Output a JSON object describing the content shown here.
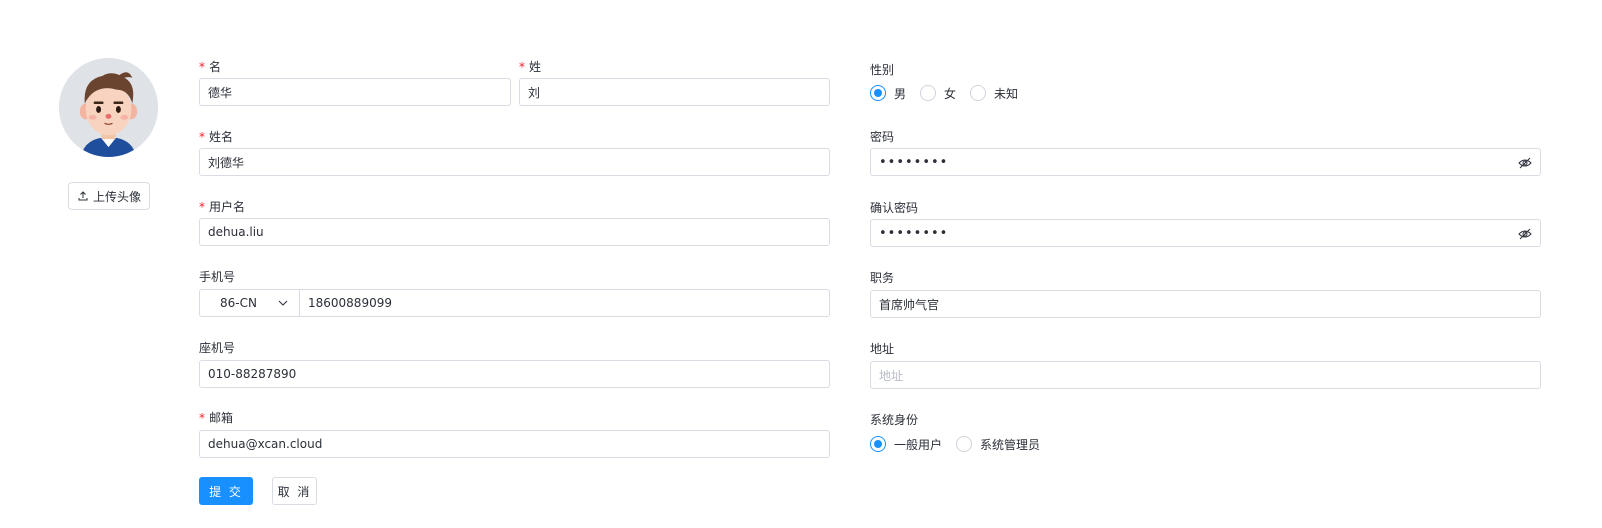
{
  "avatar": {
    "upload_label": "上传头像"
  },
  "form": {
    "first_name": {
      "label": "名",
      "value": "德华",
      "required": true
    },
    "last_name": {
      "label": "姓",
      "value": "刘",
      "required": true
    },
    "full_name": {
      "label": "姓名",
      "value": "刘德华",
      "required": true
    },
    "username": {
      "label": "用户名",
      "value": "dehua.liu",
      "required": true
    },
    "mobile": {
      "label": "手机号",
      "country_code": "86-CN",
      "value": "18600889099"
    },
    "landline": {
      "label": "座机号",
      "value": "010-88287890"
    },
    "email": {
      "label": "邮箱",
      "value": "dehua@xcan.cloud",
      "required": true
    },
    "gender": {
      "label": "性别",
      "options": [
        "男",
        "女",
        "未知"
      ],
      "selected": "男"
    },
    "password": {
      "label": "密码",
      "value": "••••••••"
    },
    "confirm_password": {
      "label": "确认密码",
      "value": "••••••••"
    },
    "title": {
      "label": "职务",
      "value": "首席帅气官"
    },
    "address": {
      "label": "地址",
      "placeholder": "地址",
      "value": ""
    },
    "system_role": {
      "label": "系统身份",
      "options": [
        "一般用户",
        "系统管理员"
      ],
      "selected": "一般用户"
    }
  },
  "actions": {
    "submit": "提 交",
    "cancel": "取 消"
  },
  "colors": {
    "primary": "#1890ff",
    "required": "#f5222d",
    "border": "#d9dce3"
  }
}
